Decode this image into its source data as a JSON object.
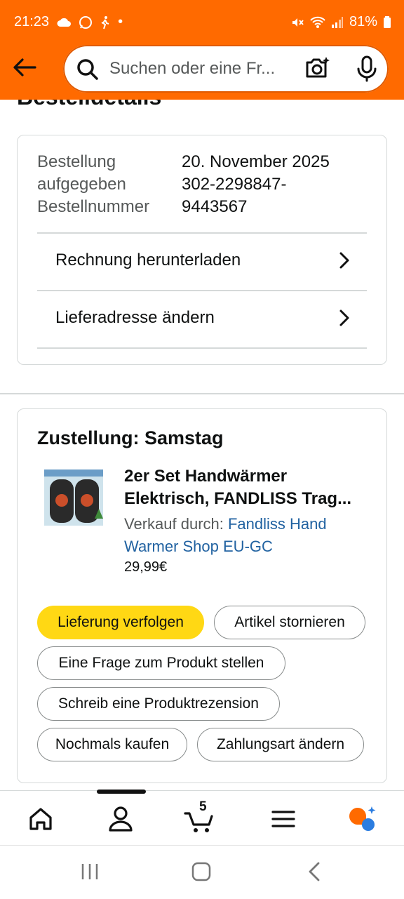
{
  "status": {
    "time": "21:23",
    "dot": "•",
    "battery": "81%",
    "icons": [
      "cloud-icon",
      "whatsapp-icon",
      "walk-icon",
      "mute-icon",
      "wifi-icon",
      "signal-icon",
      "battery-icon"
    ]
  },
  "header": {
    "search_placeholder": "Suchen oder eine Fr...",
    "icons": [
      "back-arrow-icon",
      "search-icon",
      "camera-icon",
      "mic-icon"
    ]
  },
  "page": {
    "title": "Bestelldetails"
  },
  "order": {
    "labels": "Bestellung\naufgegeben\nBestellnummer",
    "date": "20. November 2025",
    "number": "302-2298847-\n9443567",
    "links": [
      {
        "label": "Rechnung herunterladen"
      },
      {
        "label": "Lieferadresse ändern"
      }
    ]
  },
  "delivery": {
    "title": "Zustellung: Samstag",
    "product": {
      "title_line1": "2er Set Handwärmer",
      "title_line2": "Elektrisch, FANDLISS Trag...",
      "seller_prefix": "Verkauf durch: ",
      "seller_link": "Fandliss Hand Warmer Shop EU-GC",
      "price": "29,99€"
    },
    "actions": {
      "track": "Lieferung verfolgen",
      "cancel": "Artikel stornieren",
      "question": "Eine Frage zum Produkt stellen",
      "review": "Schreib eine Produktrezension",
      "buy_again": "Nochmals kaufen",
      "change_payment": "Zahlungsart ändern"
    }
  },
  "bottom_nav": {
    "cart_count": "5",
    "items": [
      "home-icon",
      "account-icon",
      "cart-icon",
      "menu-icon",
      "rufus-icon"
    ],
    "active": "account-icon"
  },
  "colors": {
    "header_bg": "#ff6a00",
    "primary_button": "#ffd814",
    "link": "#2162a1"
  }
}
